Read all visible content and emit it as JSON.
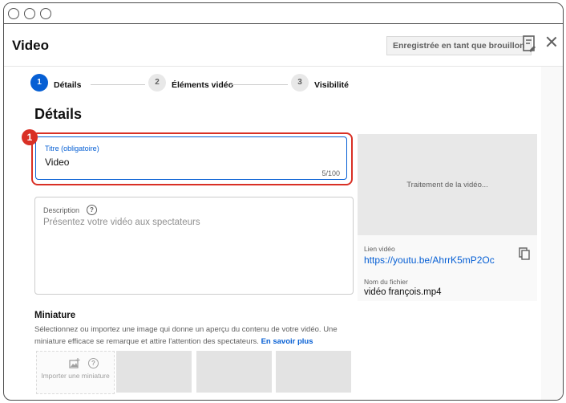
{
  "dialog": {
    "title": "Video",
    "draft_status": "Enregistrée en tant que brouillon"
  },
  "stepper": {
    "steps": [
      {
        "number": "1",
        "label": "Détails",
        "active": true
      },
      {
        "number": "2",
        "label": "Éléments vidéo",
        "active": false
      },
      {
        "number": "3",
        "label": "Visibilité",
        "active": false
      }
    ]
  },
  "details": {
    "section_title": "Détails",
    "annotation_badge": "1",
    "title_field": {
      "label": "Titre (obligatoire)",
      "value": "Video",
      "char_count": "5/100"
    },
    "description_field": {
      "label": "Description",
      "help_glyph": "?",
      "placeholder": "Présentez votre vidéo aux spectateurs"
    }
  },
  "preview": {
    "processing_text": "Traitement de la vidéo...",
    "link_label": "Lien vidéo",
    "link_url": "https://youtu.be/AhrrK5mP2Oc",
    "filename_label": "Nom du fichier",
    "filename": "vidéo françois.mp4"
  },
  "thumbnail": {
    "title": "Miniature",
    "description": "Sélectionnez ou importez une image qui donne un aperçu du contenu de votre vidéo. Une miniature efficace se remarque et attire l'attention des spectateurs.",
    "learn_more": "En savoir plus",
    "upload_label": "Importer une miniature",
    "help_glyph": "?"
  },
  "colors": {
    "accent_blue": "#065fd4",
    "highlight_red": "#d93025"
  },
  "icons": {
    "close": "close-icon",
    "feedback": "feedback-icon",
    "copy": "copy-icon",
    "add_image": "add-image-icon",
    "help": "help-icon"
  }
}
